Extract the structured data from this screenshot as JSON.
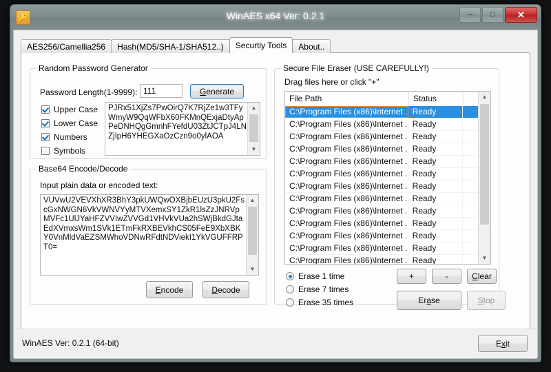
{
  "window": {
    "title": "WinAES x64 Ver: 0.2.1",
    "icon": "key-icon",
    "minimize_label": "─",
    "maximize_label": "□",
    "close_label": "✕"
  },
  "tabs": [
    {
      "label": "AES256/Camellia256",
      "active": false
    },
    {
      "label": "Hash(MD5/SHA-1/SHA512..)",
      "active": false
    },
    {
      "label": "Securtiy Tools",
      "active": true
    },
    {
      "label": "About..",
      "active": false
    }
  ],
  "password_generator": {
    "legend": "Random Password Generator",
    "length_label": "Password Length(1-9999):",
    "length_value": "111",
    "generate_button": "Generate",
    "generate_accel": "G",
    "options": [
      {
        "label": "Upper Case",
        "checked": true
      },
      {
        "label": "Lower Case",
        "checked": true
      },
      {
        "label": "Numbers",
        "checked": true
      },
      {
        "label": "Symbols",
        "checked": false
      }
    ],
    "output": "PJRx51XjZs7PwOirQ7K7RjZe1w3TFyWmyW9QqWFbX60FKMnQExjaDtyApPeDNHQgGmnhFYefdU03ZtJCTpJ4LNZjIpH6YHEGXaOzCzn9o0ylAOA"
  },
  "base64": {
    "legend": "Base64 Encode/Decode",
    "input_label": "Input plain data or encoded text:",
    "input_value": "VUVwU2VEVXhXR3BhY3pkUWQwOXBjbEUzU3pkU2FscGxNWGN6VkVWNVYyMTVXemxSY1ZkR1lsZzJNRVpMVFc1UlJYaHFZVVIwZVVGd1VHVkVUa2hSWjBkdGJtaEdXVmxsWm1SVk1ETmFkRXBEVkhCS05FeE9XbXBKY0VnMldVaEZSMWhoVDNwRFdtNDViekI1YkVGUFFRPT0=",
    "encode_button": "Encode",
    "encode_accel": "E",
    "decode_button": "Decode",
    "decode_accel": "D"
  },
  "eraser": {
    "legend": "Secure File Eraser (USE CAREFULLY!)",
    "hint": "Drag files here or click \"+\"",
    "columns": [
      "File Path",
      "Status",
      ""
    ],
    "rows": [
      {
        "path": "C:\\Program Files (x86)\\Internet ...",
        "status": "Ready",
        "selected": true
      },
      {
        "path": "C:\\Program Files (x86)\\Internet ...",
        "status": "Ready",
        "selected": false
      },
      {
        "path": "C:\\Program Files (x86)\\Internet ...",
        "status": "Ready",
        "selected": false
      },
      {
        "path": "C:\\Program Files (x86)\\Internet ...",
        "status": "Ready",
        "selected": false
      },
      {
        "path": "C:\\Program Files (x86)\\Internet ...",
        "status": "Ready",
        "selected": false
      },
      {
        "path": "C:\\Program Files (x86)\\Internet ...",
        "status": "Ready",
        "selected": false
      },
      {
        "path": "C:\\Program Files (x86)\\Internet ...",
        "status": "Ready",
        "selected": false
      },
      {
        "path": "C:\\Program Files (x86)\\Internet ...",
        "status": "Ready",
        "selected": false
      },
      {
        "path": "C:\\Program Files (x86)\\Internet ...",
        "status": "Ready",
        "selected": false
      },
      {
        "path": "C:\\Program Files (x86)\\Internet ...",
        "status": "Ready",
        "selected": false
      },
      {
        "path": "C:\\Program Files (x86)\\Internet ...",
        "status": "Ready",
        "selected": false
      },
      {
        "path": "C:\\Program Files (x86)\\Internet ...",
        "status": "Ready",
        "selected": false
      },
      {
        "path": "C:\\Program Files (x86)\\Internet ...",
        "status": "Ready",
        "selected": false
      },
      {
        "path": "C:\\Program Files (x86)\\Internet ...",
        "status": "Ready",
        "selected": false
      }
    ],
    "erase_modes": [
      {
        "label": "Erase 1 time",
        "checked": true
      },
      {
        "label": "Erase 7 times",
        "checked": false
      },
      {
        "label": "Erase 35 times",
        "checked": false
      }
    ],
    "add_button": "+",
    "remove_button": "-",
    "clear_button": "Clear",
    "clear_accel": "C",
    "erase_button": "Erase",
    "erase_accel": "a",
    "stop_button": "Stop",
    "stop_accel": "S",
    "stop_disabled": true
  },
  "statusbar": {
    "text": "WinAES Ver: 0.2.1 (64-bit)",
    "exit_button": "Exit",
    "exit_accel": "x"
  },
  "colors": {
    "accent_selection": "#2a8fe0",
    "titlebar": "#7c8a8c",
    "close_button": "#c7302f",
    "icon_orange": "#e09b2e"
  }
}
